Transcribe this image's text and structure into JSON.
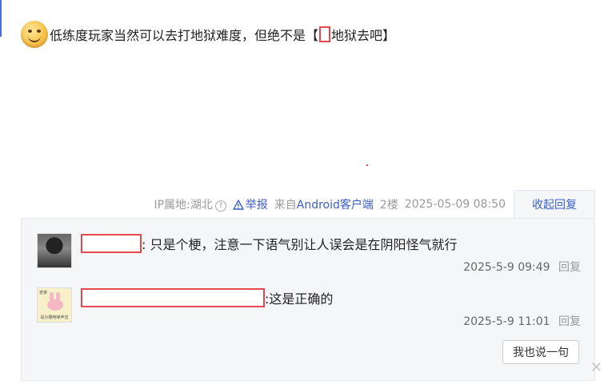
{
  "post": {
    "emoji_icon": "smiley-face-icon",
    "text_before": "低练度玩家当然可以去打地狱难度，但绝不是【",
    "text_after": "地狱去吧】"
  },
  "meta": {
    "ip_location": "IP属地:湖北",
    "help_icon": "?",
    "report_label": "举报",
    "source_prefix": "来自",
    "source_app": "Android客户端",
    "floor": "2楼",
    "timestamp": "2025-05-09 08:50",
    "collapse_label": "收起回复"
  },
  "replies": [
    {
      "avatar_icon": "anime-character-avatar",
      "text": ": 只是个梗，注意一下语气别让人误会是在阴阳怪气就行",
      "time": "2025-5-9 09:49",
      "reply_label": "回复"
    },
    {
      "avatar_icon": "pink-bunny-avatar",
      "avatar_tag": "老婆",
      "avatar_caption": "是沙雕咆哮声音",
      "text": ":这是正确的",
      "time": "2025-5-9 11:01",
      "reply_label": "回复"
    }
  ],
  "say_button_label": "我也说一句",
  "colors": {
    "accent_blue": "#3b5ec7",
    "redaction_red": "#e5484d",
    "panel_bg": "#f5f6f8"
  }
}
